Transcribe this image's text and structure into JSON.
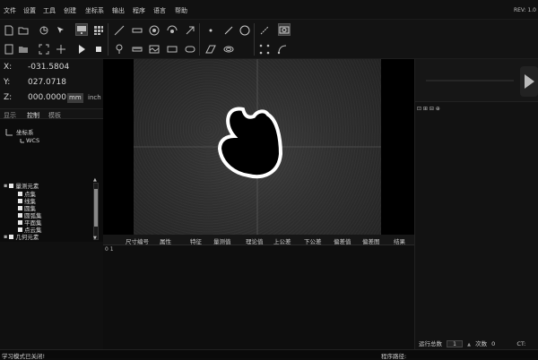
{
  "menu": {
    "items": [
      "文件",
      "设置",
      "工具",
      "创建",
      "坐标系",
      "输出",
      "程序",
      "语言",
      "帮助"
    ],
    "rev": "REV: 1.0"
  },
  "toolbar": {
    "icons": [
      "open-file-icon",
      "save-icon",
      "load-icon",
      "snap-icon",
      "pointer-icon",
      "monitor-icon",
      "grid-icon",
      "line-tool-icon",
      "measure-icon",
      "circle-icon",
      "profile-icon",
      "focus-icon",
      "point-icon",
      "line-icon",
      "circle-outline-icon",
      "segment-icon",
      "camera-icon",
      "document-icon",
      "folder-icon",
      "scan-icon",
      "edge-icon",
      "play-icon",
      "stop-icon",
      "probe-icon",
      "ruler-icon",
      "frame-icon",
      "rectangle-icon",
      "parallel-icon",
      "ring-icon",
      "connect-icon",
      "curve-icon"
    ]
  },
  "coords": {
    "x_label": "X:",
    "x": "-031.5804",
    "y_label": "Y:",
    "y": "027.0718",
    "z_label": "Z:",
    "z": "000.0000",
    "unit_mm": "mm",
    "unit_inch": "inch"
  },
  "tabs": [
    "显示",
    "控制",
    "模板"
  ],
  "tree": {
    "root": "坐标系",
    "child": "WCS"
  },
  "elements": {
    "group": "量测元素",
    "items": [
      "点集",
      "线集",
      "圆集",
      "圆弧集",
      "平面集",
      "点云集"
    ],
    "next_group": "几何元素"
  },
  "results": {
    "columns": [
      "尺寸编号",
      "属性",
      "特征",
      "量测值",
      "理论值",
      "上公差",
      "下公差",
      "偏差值",
      "偏差图",
      "结果"
    ],
    "row_index": "0 1"
  },
  "right_panel": {
    "icons": "⊡ ⊞ ⊟ ⊕",
    "run_total_label": "运行总数",
    "run_total": "1",
    "count_label": "次数",
    "count": "0",
    "ct_label": "CT:"
  },
  "status": {
    "left": "学习模式已关闭!",
    "right": "程序路径:"
  },
  "colors": {
    "background": "#0c0c0c",
    "panel": "#121212",
    "accent_selected": "#3a3a3a"
  }
}
